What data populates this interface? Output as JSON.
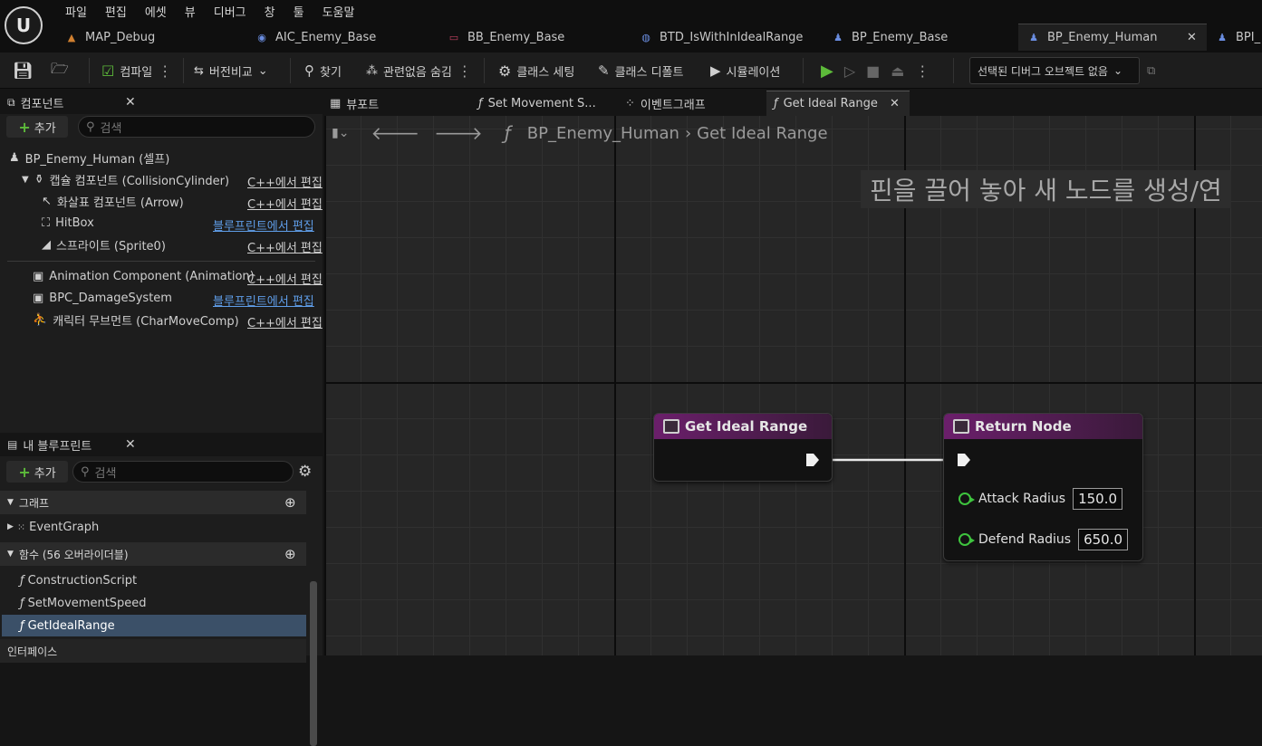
{
  "menu": [
    "파일",
    "편집",
    "에셋",
    "뷰",
    "디버그",
    "창",
    "툴",
    "도움말"
  ],
  "doc_tabs": [
    {
      "label": "MAP_Debug",
      "icon": "map-icon",
      "color": "#d08030"
    },
    {
      "label": "AIC_Enemy_Base",
      "icon": "ai-controller-icon",
      "color": "#6a8de0"
    },
    {
      "label": "BB_Enemy_Base",
      "icon": "blackboard-icon",
      "color": "#c04060"
    },
    {
      "label": "BTD_IsWithInIdealRange",
      "icon": "behavior-tree-decorator-icon",
      "color": "#6a8de0"
    },
    {
      "label": "BP_Enemy_Base",
      "icon": "character-blueprint-icon",
      "color": "#6a8de0"
    },
    {
      "label": "BP_Enemy_Human",
      "icon": "character-blueprint-icon",
      "color": "#6a8de0"
    },
    {
      "label": "BPI_",
      "icon": "interface-icon",
      "color": "#6a8de0"
    }
  ],
  "toolbar": {
    "compile": "컴파일",
    "diff": "버전비교",
    "find": "찾기",
    "hide_unrelated": "관련없음 숨김",
    "class_settings": "클래스 세팅",
    "class_defaults": "클래스 디폴트",
    "simulation": "시뮬레이션",
    "debug_object": "선택된 디버그 오브젝트 없음"
  },
  "components_panel": {
    "title": "컴포넌트",
    "add_label": "추가",
    "search_placeholder": "검색",
    "root": "BP_Enemy_Human (셀프)",
    "items": [
      {
        "label": "캡슐 컴포넌트 (CollisionCylinder)",
        "edit": "C++에서 편집",
        "edit_type": "cpp",
        "icon": "capsule-icon"
      },
      {
        "label": "화살표 컴포넌트 (Arrow)",
        "edit": "C++에서 편집",
        "edit_type": "cpp",
        "icon": "arrow-icon"
      },
      {
        "label": "HitBox",
        "edit": "블루프린트에서 편집",
        "edit_type": "bp",
        "icon": "box-collision-icon"
      },
      {
        "label": "스프라이트 (Sprite0)",
        "edit": "C++에서 편집",
        "edit_type": "cpp",
        "icon": "sprite-icon"
      },
      {
        "label": "Animation Component (Animation)",
        "edit": "C++에서 편집",
        "edit_type": "cpp",
        "icon": "component-icon"
      },
      {
        "label": "BPC_DamageSystem",
        "edit": "블루프린트에서 편집",
        "edit_type": "bp",
        "icon": "component-icon"
      },
      {
        "label": "캐릭터 무브먼트 (CharMoveComp)",
        "edit": "C++에서 편집",
        "edit_type": "cpp",
        "icon": "movement-icon"
      }
    ]
  },
  "my_blueprint": {
    "title": "내 블루프린트",
    "add_label": "추가",
    "search_placeholder": "검색",
    "graphs_section": "그래프",
    "graphs": [
      "EventGraph"
    ],
    "functions_section": "함수 (56 오버라이더블)",
    "functions": [
      "ConstructionScript",
      "SetMovementSpeed",
      "GetIdealRange"
    ],
    "interfaces_section": "인터페이스"
  },
  "graph_tabs": [
    {
      "label": "뷰포트",
      "icon": "viewport-icon"
    },
    {
      "label": "Set Movement S...",
      "icon": "function-icon"
    },
    {
      "label": "이벤트그래프",
      "icon": "event-graph-icon"
    },
    {
      "label": "Get Ideal Range",
      "icon": "function-icon"
    }
  ],
  "breadcrumb": {
    "root": "BP_Enemy_Human",
    "current": "Get Ideal Range"
  },
  "hint": "핀을 끌어 놓아 새 노드를 생성/연",
  "nodes": {
    "entry": {
      "title": "Get Ideal Range"
    },
    "return": {
      "title": "Return Node",
      "pins": [
        {
          "label": "Attack Radius",
          "value": "150.0"
        },
        {
          "label": "Defend Radius",
          "value": "650.0"
        }
      ]
    }
  },
  "colors": {
    "node_header": "#6b1f6b",
    "pin_float": "#3ec43e",
    "accent_play": "#5dbb3a",
    "link": "#5f9de8",
    "selection": "#3b5068"
  }
}
